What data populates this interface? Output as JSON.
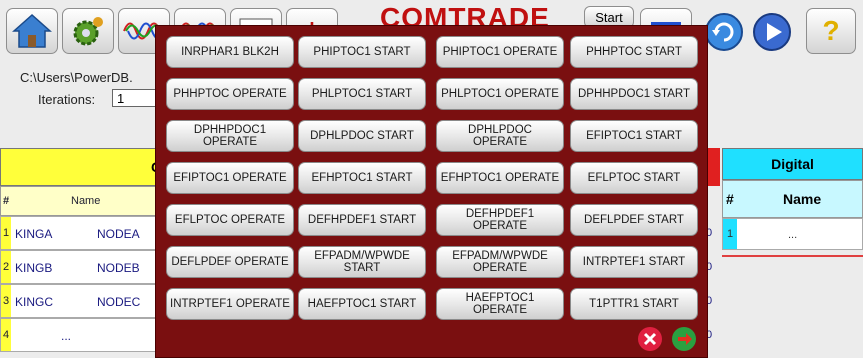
{
  "toolbar": {
    "title": "COMTRADE",
    "start_label": "Start",
    "buttons": [
      "home-icon",
      "settings-icon",
      "waveform-icon",
      "waveform-icon",
      "table-icon",
      "star-icon",
      "list-icon",
      "refresh-icon",
      "play-icon",
      "help-icon"
    ]
  },
  "settings": {
    "path": "C:\\Users\\PowerDB.",
    "iterations_label": "Iterations:",
    "iterations_value": "1"
  },
  "analog_table": {
    "header_char": "C",
    "col_num": "#",
    "col_name": "Name",
    "rows": [
      {
        "num": "1",
        "a": "KINGA",
        "b": "NODEA"
      },
      {
        "num": "2",
        "a": "KINGB",
        "b": "NODEB"
      },
      {
        "num": "3",
        "a": "KINGC",
        "b": "NODEC"
      },
      {
        "num": "4",
        "a": "...",
        "b": ""
      }
    ],
    "zero_values": [
      "0",
      "0",
      "0",
      "0"
    ]
  },
  "digital_table": {
    "title": "Digital",
    "col_num": "#",
    "col_name": "Name",
    "rows": [
      {
        "num": "1",
        "name": "..."
      }
    ]
  },
  "dialog": {
    "signals": [
      "INRPHAR1 BLK2H",
      "PHIPTOC1 START",
      "PHIPTOC1 OPERATE",
      "PHHPTOC START",
      "PHHPTOC OPERATE",
      "PHLPTOC1 START",
      "PHLPTOC1 OPERATE",
      "DPHHPDOC1 START",
      "DPHHPDOC1 OPERATE",
      "DPHLPDOC START",
      "DPHLPDOC OPERATE",
      "EFIPTOC1 START",
      "EFIPTOC1 OPERATE",
      "EFHPTOC1 START",
      "EFHPTOC1 OPERATE",
      "EFLPTOC START",
      "EFLPTOC OPERATE",
      "DEFHPDEF1 START",
      "DEFHPDEF1 OPERATE",
      "DEFLPDEF START",
      "DEFLPDEF OPERATE",
      "EFPADM/WPWDE START",
      "EFPADM/WPWDE OPERATE",
      "INTRPTEF1 START",
      "INTRPTEF1 OPERATE",
      "HAEFPTOC1 START",
      "HAEFPTOC1 OPERATE",
      "T1PTTR1 START"
    ],
    "close_icon": "close-icon",
    "ok_icon": "accept-icon"
  }
}
